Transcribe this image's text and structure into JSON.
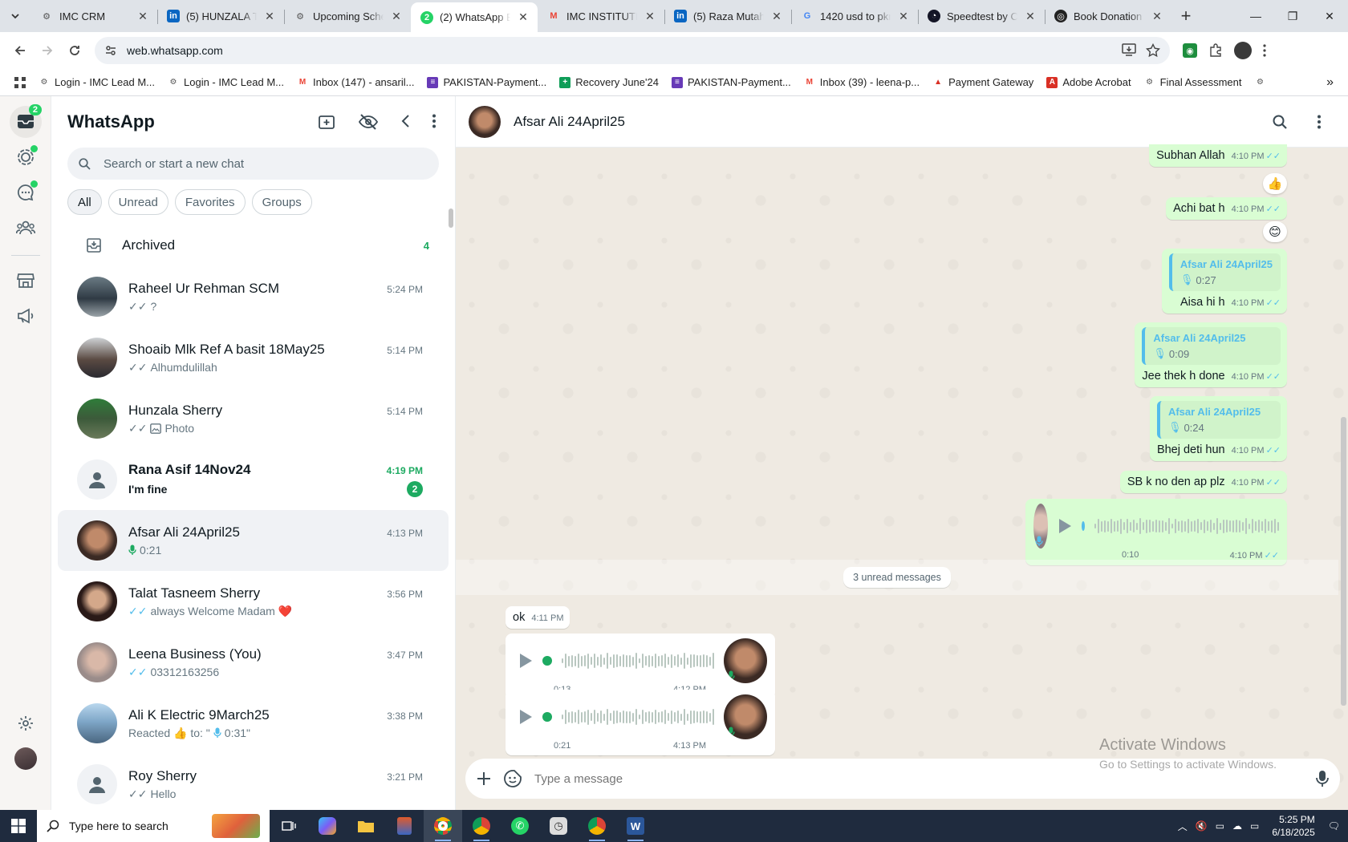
{
  "browser": {
    "tabs": [
      {
        "label": "IMC CRM",
        "favicon": "imc-icon"
      },
      {
        "label": "(5) HUNZALA TA",
        "favicon": "linkedin-icon"
      },
      {
        "label": "Upcoming Sche",
        "favicon": "imc-icon"
      },
      {
        "label": "(2) WhatsApp Bu",
        "favicon": "whatsapp-icon",
        "badge": "2"
      },
      {
        "label": "IMC INSTITUTE |",
        "favicon": "gmail-icon"
      },
      {
        "label": "(5) Raza Mutahi",
        "favicon": "linkedin-icon"
      },
      {
        "label": "1420 usd to pkr",
        "favicon": "google-icon"
      },
      {
        "label": "Speedtest by Oo",
        "favicon": "speedtest-icon"
      },
      {
        "label": "Book Donation",
        "favicon": "book-icon"
      }
    ],
    "url": "web.whatsapp.com",
    "bookmarks": [
      "Login - IMC Lead M...",
      "Login - IMC Lead M...",
      "Inbox (147) - ansaril...",
      "PAKISTAN-Payment...",
      "Recovery June'24",
      "PAKISTAN-Payment...",
      "Inbox (39) - leena-p...",
      "Payment Gateway",
      "Adobe Acrobat",
      "Final Assessment"
    ]
  },
  "rail": {
    "chats_badge": "2"
  },
  "sidebar": {
    "title": "WhatsApp",
    "search_placeholder": "Search or start a new chat",
    "filters": [
      "All",
      "Unread",
      "Favorites",
      "Groups"
    ],
    "archived": {
      "label": "Archived",
      "count": "4"
    },
    "chats": [
      {
        "name": "Raheel Ur Rehman SCM",
        "time": "5:24 PM",
        "preview": "?",
        "ticks": "grey"
      },
      {
        "name": "Shoaib Mlk Ref A basit 18May25",
        "time": "5:14 PM",
        "preview": "Alhumdulillah",
        "ticks": "grey"
      },
      {
        "name": "Hunzala Sherry",
        "time": "5:14 PM",
        "preview": "Photo",
        "ticks": "grey"
      },
      {
        "name": "Rana Asif 14Nov24",
        "time": "4:19 PM",
        "preview": "I'm fine",
        "unread": "2"
      },
      {
        "name": "Afsar Ali 24April25",
        "time": "4:13 PM",
        "preview": "0:21"
      },
      {
        "name": "Talat Tasneem Sherry",
        "time": "3:56 PM",
        "preview": "always Welcome Madam ❤️",
        "ticks": "blue"
      },
      {
        "name": "Leena Business (You)",
        "time": "3:47 PM",
        "preview": "03312163256",
        "ticks": "blue"
      },
      {
        "name": "Ali K Electric 9March25",
        "time": "3:38 PM",
        "preview_a": "Reacted 👍 to: \"",
        "preview_b": "0:31\""
      },
      {
        "name": "Roy Sherry",
        "time": "3:21 PM",
        "preview": "Hello",
        "ticks": "grey"
      }
    ]
  },
  "conversation": {
    "contact": "Afsar Ali 24April25",
    "messages": {
      "m1": {
        "text": "Subhan Allah",
        "time": "4:10 PM",
        "reaction": "👍"
      },
      "m2": {
        "text": "Achi bat h",
        "time": "4:10 PM",
        "reaction": "😊"
      },
      "m3": {
        "quote_name": "Afsar Ali 24April25",
        "quote_duration": "0:27",
        "text": "Aisa hi h",
        "time": "4:10 PM"
      },
      "m4": {
        "quote_name": "Afsar Ali 24April25",
        "quote_duration": "0:09",
        "text": "Jee thek h done",
        "time": "4:10 PM"
      },
      "m5": {
        "quote_name": "Afsar Ali 24April25",
        "quote_duration": "0:24",
        "text": "Bhej deti hun",
        "time": "4:10 PM"
      },
      "m6": {
        "text": "SB k no den ap plz",
        "time": "4:10 PM"
      },
      "v1": {
        "duration": "0:10",
        "time": "4:10 PM"
      },
      "unread_banner": "3 unread messages",
      "m7": {
        "text": "ok",
        "time": "4:11 PM"
      },
      "v2": {
        "duration": "0:13",
        "time": "4:12 PM"
      },
      "v3": {
        "duration": "0:21",
        "time": "4:13 PM"
      }
    },
    "composer_placeholder": "Type a message"
  },
  "watermark": {
    "line1": "Activate Windows",
    "line2": "Go to Settings to activate Windows."
  },
  "taskbar": {
    "search_placeholder": "Type here to search",
    "time": "5:25 PM",
    "date": "6/18/2025"
  },
  "colors": {
    "whatsapp_green": "#25d366",
    "unread_green": "#1daa61",
    "outgoing_bubble": "#d9fdd3",
    "read_ticks": "#53bdeb"
  }
}
